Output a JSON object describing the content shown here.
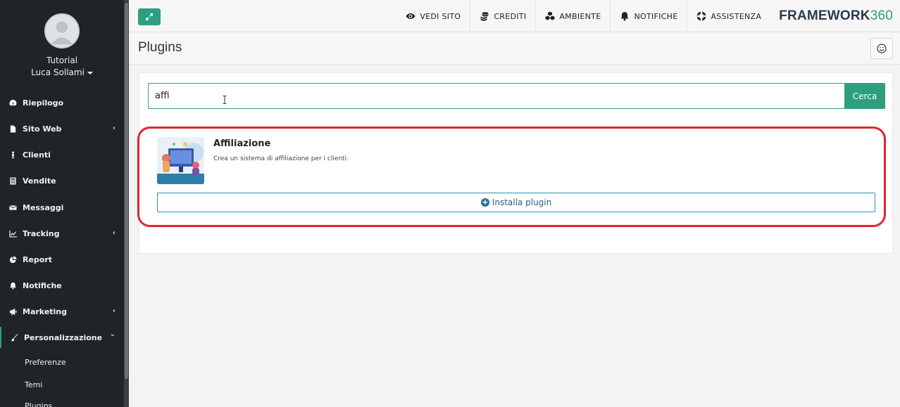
{
  "sidebar": {
    "user": {
      "org": "Tutorial",
      "name": "Luca Sollami"
    },
    "items": [
      {
        "label": "Riepilogo",
        "icon": "dashboard-icon",
        "chevron": ""
      },
      {
        "label": "Sito Web",
        "icon": "file-icon",
        "chevron": "‹"
      },
      {
        "label": "Clienti",
        "icon": "person-icon",
        "chevron": ""
      },
      {
        "label": "Vendite",
        "icon": "calculator-icon",
        "chevron": ""
      },
      {
        "label": "Messaggi",
        "icon": "envelope-icon",
        "chevron": ""
      },
      {
        "label": "Tracking",
        "icon": "line-chart-icon",
        "chevron": "‹"
      },
      {
        "label": "Report",
        "icon": "pie-chart-icon",
        "chevron": ""
      },
      {
        "label": "Notifiche",
        "icon": "bell-icon",
        "chevron": ""
      },
      {
        "label": "Marketing",
        "icon": "bullhorn-icon",
        "chevron": "‹"
      },
      {
        "label": "Personalizzazione",
        "icon": "brush-icon",
        "chevron": "⌄"
      }
    ],
    "subitems": [
      {
        "label": "Preferenze"
      },
      {
        "label": "Temi"
      },
      {
        "label": "Plugins"
      }
    ]
  },
  "topbar": {
    "links": [
      {
        "label": "VEDI SITO",
        "icon": "eye-icon"
      },
      {
        "label": "CREDITI",
        "icon": "coins-icon"
      },
      {
        "label": "AMBIENTE",
        "icon": "cubes-icon"
      },
      {
        "label": "NOTIFICHE",
        "icon": "bell-icon"
      },
      {
        "label": "ASSISTENZA",
        "icon": "lifebuoy-icon"
      }
    ],
    "brand": {
      "main": "FRAMEWORK",
      "accent": "360"
    }
  },
  "page": {
    "title": "Plugins"
  },
  "search": {
    "value": "affi",
    "button_label": "Cerca"
  },
  "result": {
    "name": "Affiliazione",
    "description": "Crea un sistema di affiliazione per i clienti.",
    "install_label": "Installa plugin"
  },
  "colors": {
    "accent": "#2e9e7f",
    "sidebar_bg": "#1e2428",
    "highlight": "#e0262b"
  }
}
